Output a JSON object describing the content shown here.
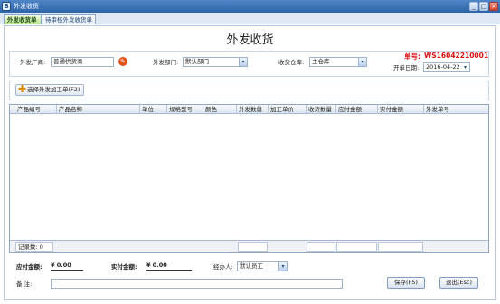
{
  "window": {
    "title": "外发收货",
    "app_icon": "B"
  },
  "tabs": [
    {
      "label": "外发收货单"
    },
    {
      "label": "待审核外发收货单"
    }
  ],
  "form": {
    "title": "外发收货",
    "supplier_label": "外发厂商:",
    "supplier_value": "普通供货商",
    "department_label": "外发部门:",
    "department_value": "默认部门",
    "warehouse_label": "收货仓库:",
    "warehouse_value": "主仓库",
    "order_no_label": "单号:",
    "order_no_value": "WS16042210001",
    "date_label": "开单日期:",
    "date_value": "2016-04-22"
  },
  "toolbar": {
    "add_button_label": "选择外发加工单(F2)"
  },
  "grid": {
    "columns": [
      "产品编号",
      "产品名称",
      "单位",
      "规格型号",
      "颜色",
      "外发数量",
      "加工单价",
      "收货数量",
      "应付金额",
      "实付金额",
      "外发单号"
    ],
    "record_count_label": "记录数:",
    "record_count_value": "0"
  },
  "summary": {
    "payable_label": "应付金额:",
    "payable_value": "¥ 0.00",
    "paid_label": "实付金额:",
    "paid_value": "¥ 0.00",
    "handler_label": "经办人:",
    "handler_value": "默认员工",
    "remark_label": "备    注:",
    "remark_value": ""
  },
  "buttons": {
    "save": "保存(F5)",
    "exit": "退出(Esc)"
  },
  "icons": {
    "combo_arrow": "▾",
    "minimize": "_",
    "maximize": "□",
    "close": "×"
  },
  "colors": {
    "order_no": "#dd1111",
    "title_bar": "#2d63a8",
    "active_tab": "#b5e08a"
  }
}
